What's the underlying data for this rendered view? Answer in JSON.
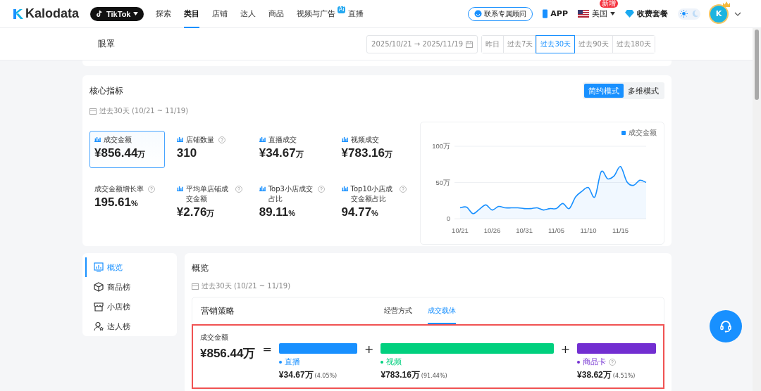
{
  "nav": {
    "logo": "Kalodata",
    "platform": "TikTok",
    "items": [
      {
        "label": "探索",
        "selected": false
      },
      {
        "label": "类目",
        "selected": true
      },
      {
        "label": "店铺",
        "selected": false
      },
      {
        "label": "达人",
        "selected": false
      },
      {
        "label": "商品",
        "selected": false
      },
      {
        "label": "视频与广告",
        "selected": false,
        "badge": "Ai"
      },
      {
        "label": "直播",
        "selected": false
      }
    ],
    "advisor": "联系专属顾问",
    "app": "APP",
    "region": "美国",
    "region_badge": "新增",
    "pricing": "收费套餐",
    "dark_mode": false,
    "avatar": "K"
  },
  "header": {
    "title": "眼罩",
    "date_start": "2025/10/21",
    "date_arrow": "→",
    "date_end": "2025/11/19",
    "periods": [
      {
        "label": "昨日",
        "selected": false
      },
      {
        "label": "过去7天",
        "selected": false
      },
      {
        "label": "过去30天",
        "selected": true
      },
      {
        "label": "过去90天",
        "selected": false
      },
      {
        "label": "过去180天",
        "selected": false
      }
    ]
  },
  "core": {
    "title": "核心指标",
    "date_range": "过去30天 (10/21 ~ 11/19)",
    "modes": [
      {
        "label": "简约模式",
        "selected": true
      },
      {
        "label": "多维模式",
        "selected": false
      }
    ],
    "metrics": [
      {
        "kind": "chartable",
        "label": "成交金额",
        "help": false,
        "value": "¥856.44",
        "unit": "万",
        "selected": true
      },
      {
        "kind": "chartable",
        "label": "店铺数量",
        "help": true,
        "value": "310",
        "selected": false
      },
      {
        "kind": "chartable",
        "label": "直播成交",
        "help": false,
        "value": "¥34.67",
        "unit": "万",
        "selected": false
      },
      {
        "kind": "chartable",
        "label": "视频成交",
        "help": false,
        "value": "¥783.16",
        "unit": "万",
        "selected": false
      },
      {
        "kind": "plain",
        "label": "成交金额增长率",
        "help": true,
        "value": "195.61",
        "unit": "%",
        "selected": false
      },
      {
        "kind": "chartable",
        "label": "平均单店铺成交金额",
        "help": true,
        "value": "¥2.76",
        "unit": "万",
        "selected": false
      },
      {
        "kind": "chartable",
        "label": "Top3小店成交占比",
        "help": true,
        "value": "89.11",
        "unit": "%",
        "selected": false
      },
      {
        "kind": "chartable",
        "label": "Top10小店成交金额占比",
        "help": true,
        "value": "94.77",
        "unit": "%",
        "selected": false
      }
    ],
    "chart_data": {
      "type": "area",
      "categories": [
        "10/21",
        null,
        null,
        null,
        null,
        "10/26",
        null,
        null,
        null,
        null,
        "10/31",
        null,
        null,
        null,
        null,
        "11/05",
        null,
        null,
        null,
        null,
        "11/10",
        null,
        null,
        null,
        null,
        "11/15",
        null,
        null,
        null,
        null
      ],
      "series": [
        {
          "name": "成交金额",
          "color": "#1890ff",
          "values": [
            15,
            16,
            7,
            13,
            19,
            12,
            17,
            15,
            15,
            15,
            14,
            14,
            15,
            12,
            14,
            14,
            21,
            14,
            30,
            38,
            43,
            30,
            65,
            55,
            59,
            72,
            51,
            46,
            53,
            50
          ]
        }
      ],
      "ylim": [
        0,
        100
      ],
      "yticks": [
        {
          "value": 0,
          "label": "0"
        },
        {
          "value": 50,
          "label": "50万"
        },
        {
          "value": 100,
          "label": "100万"
        }
      ]
    }
  },
  "sidebar": {
    "items": [
      {
        "label": "概览",
        "selected": true
      },
      {
        "label": "商品榜",
        "selected": false
      },
      {
        "label": "小店榜",
        "selected": false
      },
      {
        "label": "达人榜",
        "selected": false
      }
    ]
  },
  "overview": {
    "title": "概览",
    "date_range": "过去30天 (10/21 ~ 11/19)",
    "section": "营销策略",
    "tabs": [
      {
        "label": "经营方式",
        "selected": false
      },
      {
        "label": "成交载体",
        "selected": true
      }
    ],
    "total_label": "成交金额",
    "total": "¥856.44万",
    "equals": "=",
    "segments": [
      {
        "name": "直播",
        "color": "#1890ff",
        "amount": "¥34.67万",
        "share": "(4.05%)",
        "help": false
      },
      {
        "name": "视频",
        "color": "#00d07e",
        "amount": "¥783.16万",
        "share": "(91.44%)",
        "help": false,
        "operator": "+"
      },
      {
        "name": "商品卡",
        "color": "#722ed1",
        "amount": "¥38.62万",
        "share": "(4.51%)",
        "help": true,
        "operator": "+"
      }
    ]
  }
}
